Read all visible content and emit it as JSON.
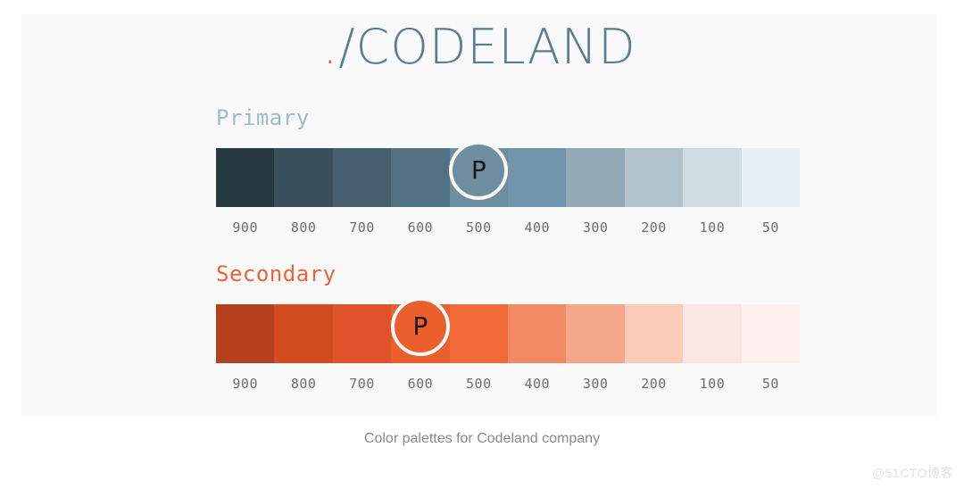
{
  "brand": {
    "dot": ".",
    "slash": "/",
    "name": "CODELAND",
    "dot_color": "#ef6239",
    "text_color": "#5b7d94"
  },
  "palettes": [
    {
      "id": "primary",
      "label": "Primary",
      "label_color": "#9fbacb",
      "marker_letter": "P",
      "marker_shade": "500",
      "shades": [
        {
          "name": "900",
          "hex": "#273a42"
        },
        {
          "name": "800",
          "hex": "#3a4f5c"
        },
        {
          "name": "700",
          "hex": "#47606f"
        },
        {
          "name": "600",
          "hex": "#527183"
        },
        {
          "name": "500",
          "hex": "#6e8ea0"
        },
        {
          "name": "400",
          "hex": "#7295ab"
        },
        {
          "name": "300",
          "hex": "#93a9b8"
        },
        {
          "name": "200",
          "hex": "#b3c3cd"
        },
        {
          "name": "100",
          "hex": "#cfdbe3"
        },
        {
          "name": "50",
          "hex": "#e8eff5"
        }
      ]
    },
    {
      "id": "secondary",
      "label": "Secondary",
      "label_color": "#ef6239",
      "marker_letter": "P",
      "marker_shade": "600",
      "shades": [
        {
          "name": "900",
          "hex": "#b4401d"
        },
        {
          "name": "800",
          "hex": "#d24c20"
        },
        {
          "name": "700",
          "hex": "#e0532a"
        },
        {
          "name": "600",
          "hex": "#ea5f2c"
        },
        {
          "name": "500",
          "hex": "#f26a38"
        },
        {
          "name": "400",
          "hex": "#f28a63"
        },
        {
          "name": "300",
          "hex": "#f5a78c"
        },
        {
          "name": "200",
          "hex": "#fbcbb7"
        },
        {
          "name": "100",
          "hex": "#fae7e3"
        },
        {
          "name": "50",
          "hex": "#fdf0ee"
        }
      ]
    }
  ],
  "caption": "Color palettes for Codeland company",
  "watermark": "@51CTO博客"
}
